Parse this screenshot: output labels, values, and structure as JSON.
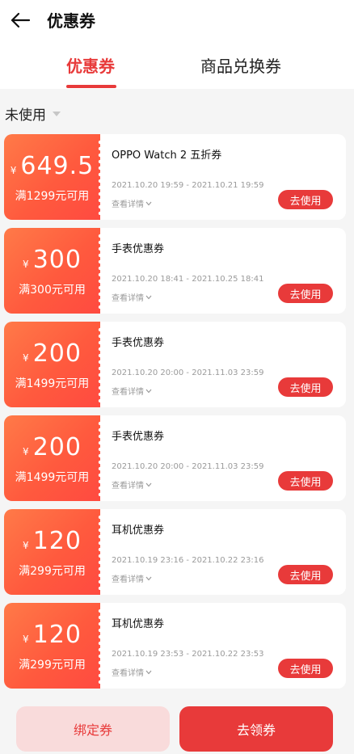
{
  "header": {
    "title": "优惠券"
  },
  "tabs": [
    {
      "label": "优惠券",
      "active": true
    },
    {
      "label": "商品兑换券",
      "active": false
    }
  ],
  "filter": {
    "label": "未使用"
  },
  "coupons": [
    {
      "currency": "¥",
      "amount": "649.5",
      "condition": "满1299元可用",
      "title": "OPPO Watch 2 五折券",
      "date": "2021.10.20 19:59 - 2021.10.21 19:59",
      "detail": "查看详情",
      "action": "去使用"
    },
    {
      "currency": "¥",
      "amount": "300",
      "condition": "满300元可用",
      "title": "手表优惠券",
      "date": "2021.10.20 18:41 - 2021.10.25 18:41",
      "detail": "查看详情",
      "action": "去使用"
    },
    {
      "currency": "¥",
      "amount": "200",
      "condition": "满1499元可用",
      "title": "手表优惠券",
      "date": "2021.10.20 20:00 - 2021.11.03 23:59",
      "detail": "查看详情",
      "action": "去使用"
    },
    {
      "currency": "¥",
      "amount": "200",
      "condition": "满1499元可用",
      "title": "手表优惠券",
      "date": "2021.10.20 20:00 - 2021.11.03 23:59",
      "detail": "查看详情",
      "action": "去使用"
    },
    {
      "currency": "¥",
      "amount": "120",
      "condition": "满299元可用",
      "title": "耳机优惠券",
      "date": "2021.10.19 23:16 - 2021.10.22 23:16",
      "detail": "查看详情",
      "action": "去使用"
    },
    {
      "currency": "¥",
      "amount": "120",
      "condition": "满299元可用",
      "title": "耳机优惠券",
      "date": "2021.10.19 23:53 - 2021.10.22 23:53",
      "detail": "查看详情",
      "action": "去使用"
    }
  ],
  "footer": {
    "bind_label": "绑定券",
    "get_label": "去领券"
  },
  "colors": {
    "accent": "#e83a3a",
    "coupon_gradient_start": "#ff7a48",
    "coupon_gradient_end": "#ff4a40",
    "bind_bg": "#f9dbdb"
  }
}
